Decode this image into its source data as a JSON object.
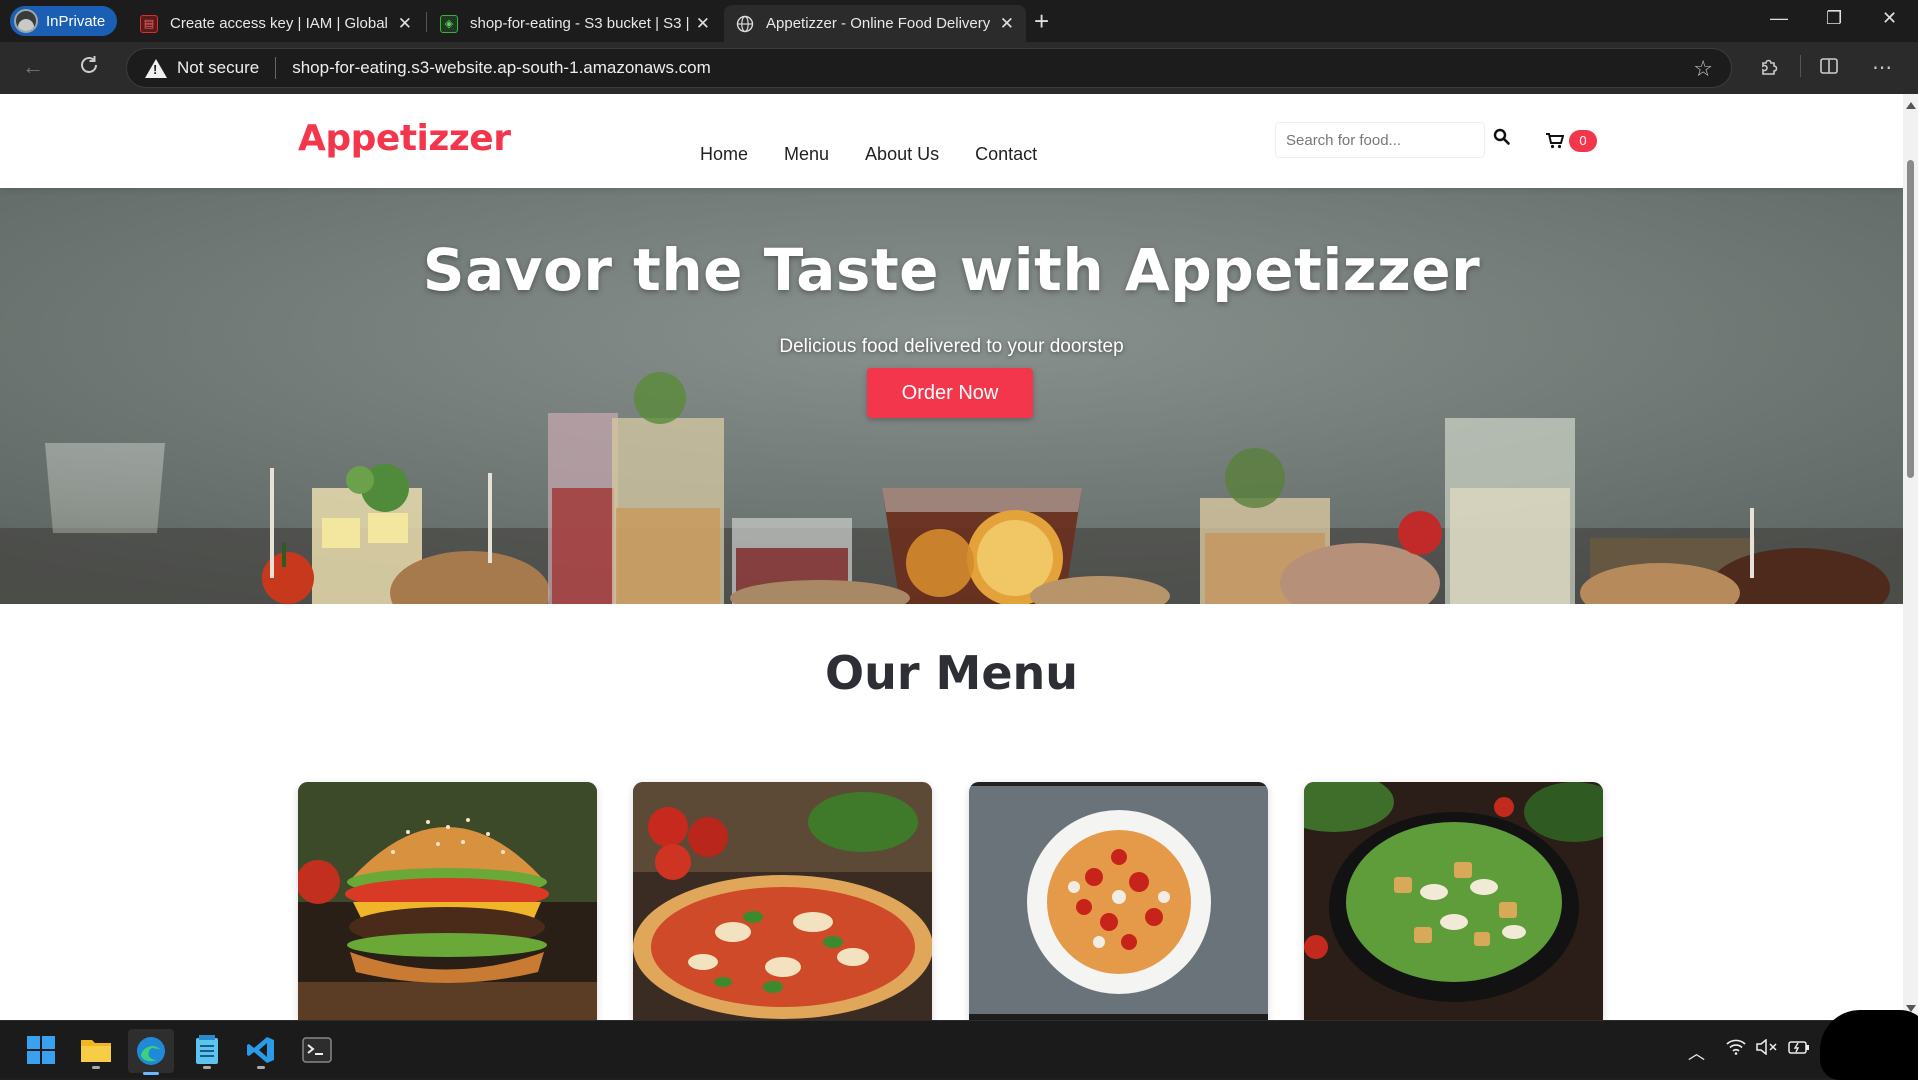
{
  "browser": {
    "profile_label": "InPrivate",
    "tabs": [
      {
        "title": "Create access key | IAM | Global",
        "favicon": "iam-icon"
      },
      {
        "title": "shop-for-eating - S3 bucket | S3 |",
        "favicon": "s3-icon"
      },
      {
        "title": "Appetizzer - Online Food Delivery",
        "favicon": "globe-icon"
      }
    ],
    "security_label": "Not secure",
    "url": "shop-for-eating.s3-website.ap-south-1.amazonaws.com"
  },
  "site": {
    "logo": "Appetizzer",
    "nav": [
      "Home",
      "Menu",
      "About Us",
      "Contact"
    ],
    "search_placeholder": "Search for food...",
    "cart_count": "0",
    "hero": {
      "title": "Savor the Taste with Appetizzer",
      "subtitle": "Delicious food delivered to your doorstep",
      "cta": "Order Now"
    },
    "section_title": "Our Menu",
    "menu_cards": [
      "burger",
      "pizza",
      "pasta",
      "salad"
    ]
  },
  "colors": {
    "brand": "#f4364c",
    "text_dark": "#2d2f35"
  }
}
